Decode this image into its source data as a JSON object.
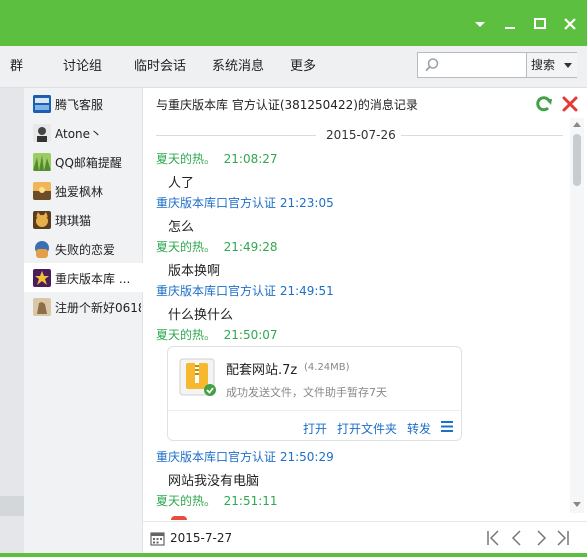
{
  "window": {
    "minimize_label": "▾",
    "maximize_label": "□",
    "close_label": "✕"
  },
  "tabs": [
    "群",
    "讨论组",
    "临时会话",
    "系统消息",
    "更多"
  ],
  "search": {
    "placeholder": "",
    "button_label": "搜索"
  },
  "contacts": [
    {
      "name": "腾飞客服",
      "icon": "tengfei-logo-avatar",
      "color": "#1b5fb3"
    },
    {
      "name": "Atone丶",
      "icon": "portrait-avatar",
      "color": "#555555"
    },
    {
      "name": "QQ邮箱提醒",
      "icon": "green-avatar",
      "color": "#7cb342"
    },
    {
      "name": "独爱枫林",
      "icon": "sunset-avatar",
      "color": "#c08a3a"
    },
    {
      "name": "琪琪猫",
      "icon": "cat-avatar",
      "color": "#d9a441"
    },
    {
      "name": "失败的恋爱",
      "icon": "cartoon-avatar",
      "color": "#3d6eb4"
    },
    {
      "name": "重庆版本库 ...",
      "icon": "group-avatar",
      "color": "#7a3b8c"
    },
    {
      "name": "注册个新好0618",
      "icon": "hand-avatar",
      "color": "#b79b73"
    }
  ],
  "active_contact_index": 6,
  "chat": {
    "header": "与重庆版本库  官方认证(381250422)的消息记录",
    "date_separator": "2015-07-26",
    "messages": [
      {
        "sender": "夏天的热。",
        "time": "21:08:27",
        "who": "me",
        "text": "人了"
      },
      {
        "sender": "重庆版本库口官方认证",
        "time": "21:23:05",
        "who": "other",
        "text": "怎么"
      },
      {
        "sender": "夏天的热。",
        "time": "21:49:28",
        "who": "me",
        "text": "版本换啊"
      },
      {
        "sender": "重庆版本库口官方认证",
        "time": "21:49:51",
        "who": "other",
        "text": "什么换什么"
      },
      {
        "sender": "夏天的热。",
        "time": "21:50:07",
        "who": "me",
        "text": ""
      },
      {
        "sender": "重庆版本库口官方认证",
        "time": "21:50:29",
        "who": "other",
        "text": "网站我没有电脑"
      },
      {
        "sender": "夏天的热。",
        "time": "21:51:11",
        "who": "me",
        "text": ""
      }
    ],
    "file": {
      "name": "配套网站.7z",
      "size": "(4.24MB)",
      "status": "成功发送文件，文件助手暂存7天",
      "actions": [
        "打开",
        "打开文件夹",
        "转发"
      ]
    }
  },
  "bottom": {
    "date": "2015-7-27"
  },
  "colors": {
    "titlebar": "#5dbf40",
    "me": "#2fa84f",
    "other": "#1d6fc7",
    "delete": "#e53935",
    "refresh": "#43a047"
  }
}
